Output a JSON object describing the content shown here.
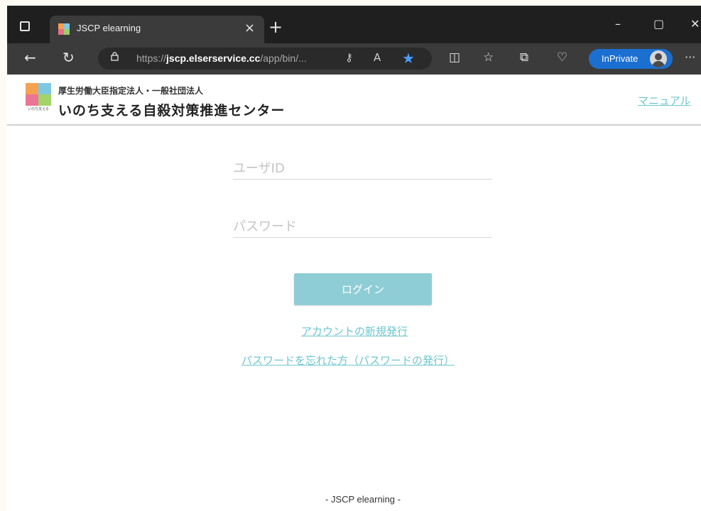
{
  "browser": {
    "tab_title": "JSCP elearning",
    "tab_close": "×",
    "new_tab": "+",
    "url_prefix": "https://",
    "url_domain": "jscp.elserservice.cc",
    "url_path": "/app/bin/...",
    "read_aloud": "A",
    "inprivate_label": "InPrivate",
    "more": "···",
    "win_minimize": "–",
    "win_restore": "▢",
    "win_close": "✕",
    "icons": [
      "tab-actions-icon",
      "back-icon",
      "refresh-icon",
      "lock-icon",
      "key-icon",
      "read-aloud-icon",
      "favorite-star-icon",
      "split-screen-icon",
      "favorites-icon",
      "collections-icon",
      "browser-essentials-icon",
      "profile-avatar-icon",
      "more-icon"
    ],
    "accent_color": "#1b6fd1"
  },
  "site": {
    "org_sub": "厚生労働大臣指定法人・一般社団法人",
    "org_name": "いのち支える自殺対策推進センター",
    "logo_caption": "いのち支える",
    "manual_link": "マニュアル",
    "link_color": "#6ec6cf"
  },
  "login": {
    "user_id_placeholder": "ユーザID",
    "password_placeholder": "パスワード",
    "login_button": "ログイン",
    "new_account_link": "アカウントの新規発行",
    "forgot_password_link": "パスワードを忘れた方（パスワードの発行）",
    "button_color": "#8fcdd6"
  },
  "footer": {
    "text": "- JSCP elearning -"
  }
}
